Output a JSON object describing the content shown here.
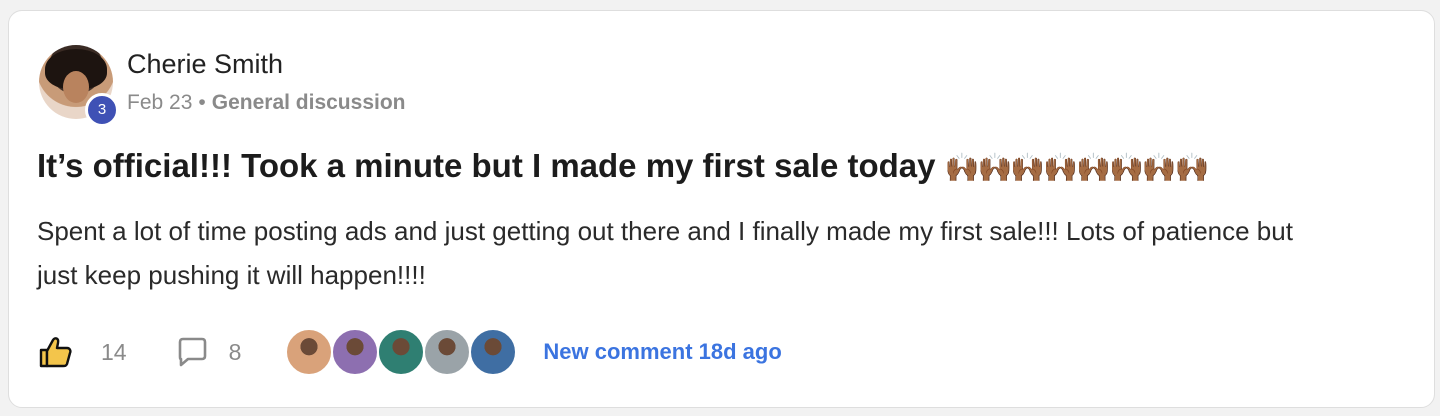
{
  "post": {
    "author": "Cherie Smith",
    "level": "3",
    "date": "Feb 23",
    "separator": "•",
    "category": "General discussion",
    "title": "It’s official!!! Took a minute but I made my first sale today",
    "title_emoji": "🙌🏾🙌🏾🙌🏾🙌🏾🙌🏾🙌🏾🙌🏾🙌🏾",
    "body": "Spent a lot of time posting ads and just getting out there and I finally made my first sale!!! Lots of patience but just keep pushing it will happen!!!!"
  },
  "footer": {
    "like_icon": "thumbs-up-icon",
    "like_count": "14",
    "comment_icon": "comment-bubble-icon",
    "comment_count": "8",
    "commenter_colors": [
      "#d9a27a",
      "#8d6fb0",
      "#2f7f72",
      "#9aa3a8",
      "#3f6ea3"
    ],
    "new_comment": "New comment 18d ago"
  },
  "colors": {
    "link": "#3b74e0",
    "badge": "#3f51b5"
  }
}
